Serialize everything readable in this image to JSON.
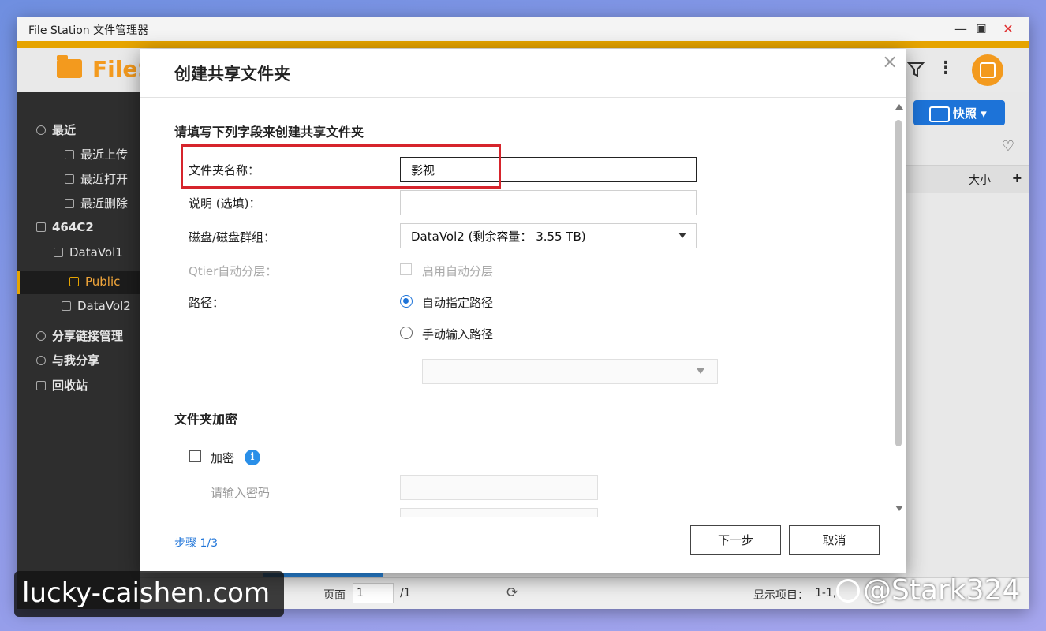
{
  "window": {
    "title": "File Station 文件管理器",
    "controls": {
      "minimize": "—",
      "maximize": "▣",
      "close": "✕"
    }
  },
  "header": {
    "logo_text": "FileS",
    "icons": [
      "folder-icon",
      "filter-icon",
      "more-vert-icon",
      "snapshot-avatar-icon"
    ]
  },
  "sidebar": {
    "items": [
      {
        "label": "最近",
        "icon": "clock-icon"
      },
      {
        "label": "最近上传",
        "icon": "list-icon"
      },
      {
        "label": "最近打开",
        "icon": "list-icon"
      },
      {
        "label": "最近删除",
        "icon": "list-icon"
      },
      {
        "label": "464C2",
        "icon": "nas-icon"
      },
      {
        "label": "DataVol1",
        "icon": "drive-icon"
      },
      {
        "label": "Public",
        "icon": "folder-icon",
        "selected": true
      },
      {
        "label": "DataVol2",
        "icon": "drive-icon"
      },
      {
        "label": "分享链接管理",
        "icon": "share-icon"
      },
      {
        "label": "与我分享",
        "icon": "shared-with-me-icon"
      },
      {
        "label": "回收站",
        "icon": "trash-icon"
      }
    ]
  },
  "right_pane": {
    "snapshot_button": "快照",
    "column_size": "大小"
  },
  "statusbar": {
    "page_label": "页面",
    "page_value": "1",
    "page_total": "/1",
    "display_label": "显示项目：",
    "display_value": "1-1,"
  },
  "dialog": {
    "title": "创建共享文件夹",
    "section_fields": "请填写下列字段来创建共享文件夹",
    "folder_name_label": "文件夹名称：",
    "folder_name_value": "影视",
    "description_label": "说明 (选填)：",
    "description_value": "",
    "disk_label": "磁盘/磁盘群组：",
    "disk_value": "DataVol2 (剩余容量： 3.55 TB)",
    "qtier_label": "Qtier自动分层：",
    "qtier_option": "启用自动分层",
    "path_label": "路径：",
    "path_auto": "自动指定路径",
    "path_manual": "手动输入路径",
    "path_select_value": "",
    "section_encryption": "文件夹加密",
    "encrypt_label": "加密",
    "password_placeholder": "请输入密码",
    "step": "步骤 1/3",
    "next_button": "下一步",
    "cancel_button": "取消"
  },
  "watermarks": {
    "left": "lucky-caishen.com",
    "right": "@Stark324"
  },
  "colors": {
    "accent_orange": "#e6a400",
    "logo_orange": "#f39a1e",
    "primary_blue": "#1d73d8",
    "highlight_red": "#d6242c",
    "sidebar_dark": "#2e2e2e"
  }
}
